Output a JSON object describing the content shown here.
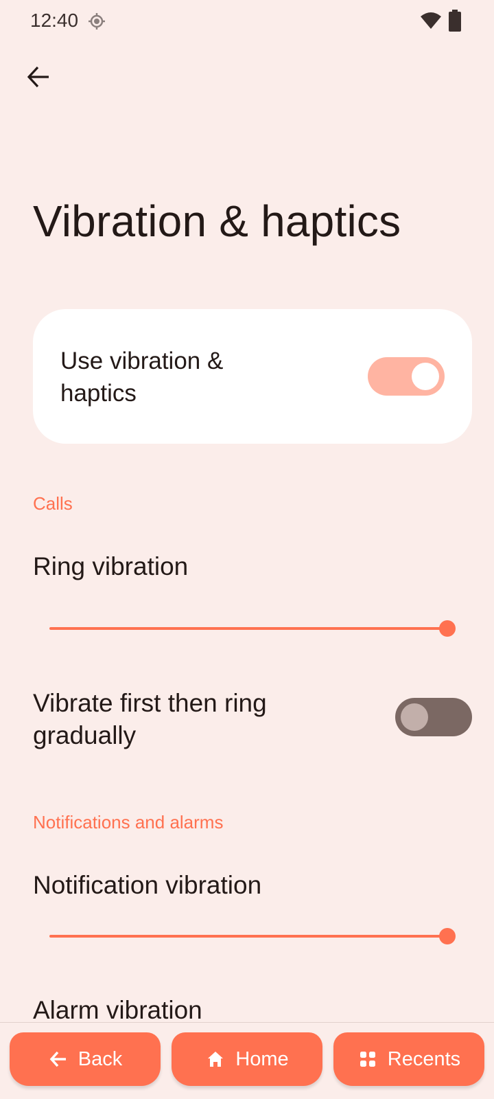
{
  "status_bar": {
    "time": "12:40",
    "icons": [
      "location-icon",
      "wifi-icon",
      "battery-icon"
    ]
  },
  "header": {
    "back_icon": "arrow-back-icon",
    "title": "Vibration & haptics"
  },
  "main_toggle": {
    "label": "Use vibration & haptics",
    "checked": true
  },
  "sections": {
    "calls": {
      "header": "Calls",
      "ring_vibration": {
        "label": "Ring vibration",
        "level": 1.0
      },
      "vibrate_first": {
        "label": "Vibrate first then ring gradually",
        "checked": false
      }
    },
    "notifications": {
      "header": "Notifications and alarms",
      "notification_vibration": {
        "label": "Notification vibration",
        "level": 1.0
      },
      "alarm_vibration": {
        "label": "Alarm vibration"
      }
    }
  },
  "bottom_nav": {
    "back_label": "Back",
    "home_label": "Home",
    "recents_label": "Recents"
  },
  "colors": {
    "background": "#FBEDEA",
    "accent": "#FF7150",
    "switch_on_track": "#FFB4A2",
    "switch_off_track": "#7B6863",
    "card": "#FFFFFF",
    "text": "#231917"
  }
}
